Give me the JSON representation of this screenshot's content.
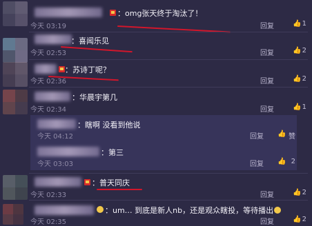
{
  "comments": [
    {
      "text": "omg张天终于淘汰了！",
      "time": "今天 03:19",
      "reply": "回复",
      "count": "1"
    },
    {
      "text": "喜闻乐见",
      "time": "今天 02:53",
      "reply": "回复",
      "count": "2"
    },
    {
      "text": "苏诗丁呢？",
      "time": "今天 02:36",
      "reply": "回复",
      "count": "2"
    },
    {
      "text": "华晨宇第几",
      "time": "今天 02:34",
      "reply": "回复",
      "count": "1"
    },
    {
      "text": "瞎啊 没看到他说",
      "time": "今天 04:12",
      "reply": "回复",
      "count": "赞"
    },
    {
      "text": "第三",
      "time": "今天 03:03",
      "reply": "回复",
      "count": "2"
    },
    {
      "text": "普天同庆",
      "time": "今天 02:33",
      "reply": "回复",
      "count": "2"
    },
    {
      "text": "um… 到底是新人nb，还是观众瞎投，等待播出",
      "time": "今天 02:35",
      "reply": "回复",
      "count": "2"
    }
  ],
  "separator": "：",
  "colors": {
    "background": "#2d2a45",
    "highlight": "#d2162b",
    "subpanel": "#37345a"
  },
  "icons": {
    "like": "thumbs-up-icon",
    "badge": "vip-crown-icon",
    "emoji": "laughing-emoji-icon"
  }
}
